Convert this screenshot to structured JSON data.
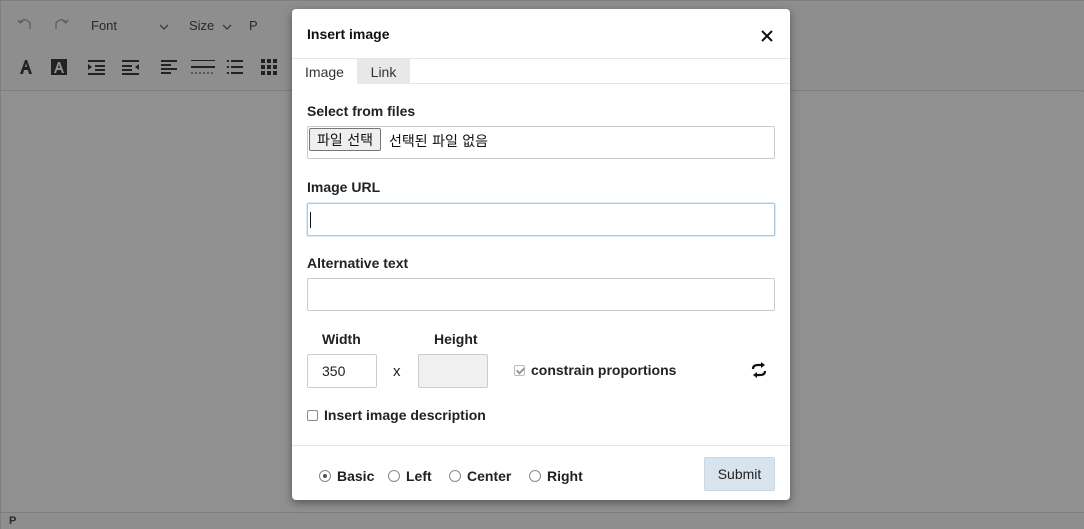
{
  "toolbar": {
    "font_label": "Font",
    "size_label": "Size",
    "format_label": "P"
  },
  "status_bar": {
    "path": "P"
  },
  "dialog": {
    "title": "Insert image",
    "tabs": [
      {
        "label": "Image",
        "active": true
      },
      {
        "label": "Link",
        "active": false
      }
    ],
    "select_files_label": "Select from files",
    "file_button_label": "파일 선택",
    "file_status": "선택된 파일 없음",
    "image_url_label": "Image URL",
    "image_url_value": "",
    "alt_text_label": "Alternative text",
    "alt_text_value": "",
    "width_label": "Width",
    "width_value": "350",
    "height_label": "Height",
    "height_value": "",
    "times_symbol": "x",
    "constrain_label": "constrain proportions",
    "constrain_checked": true,
    "description_label": "Insert image description",
    "description_checked": false,
    "align_options": [
      {
        "label": "Basic",
        "checked": true
      },
      {
        "label": "Left",
        "checked": false
      },
      {
        "label": "Center",
        "checked": false
      },
      {
        "label": "Right",
        "checked": false
      }
    ],
    "submit_label": "Submit"
  },
  "icons": {
    "undo": "undo-icon",
    "redo": "redo-icon",
    "font_color": "font-color-icon",
    "highlight_color": "highlight-color-icon",
    "indent": "indent-icon",
    "outdent": "outdent-icon",
    "align": "align-left-icon",
    "horizontal_rule": "horizontal-rule-icon",
    "list": "list-icon",
    "table": "table-icon",
    "close": "close-icon",
    "revert": "revert-icon"
  }
}
